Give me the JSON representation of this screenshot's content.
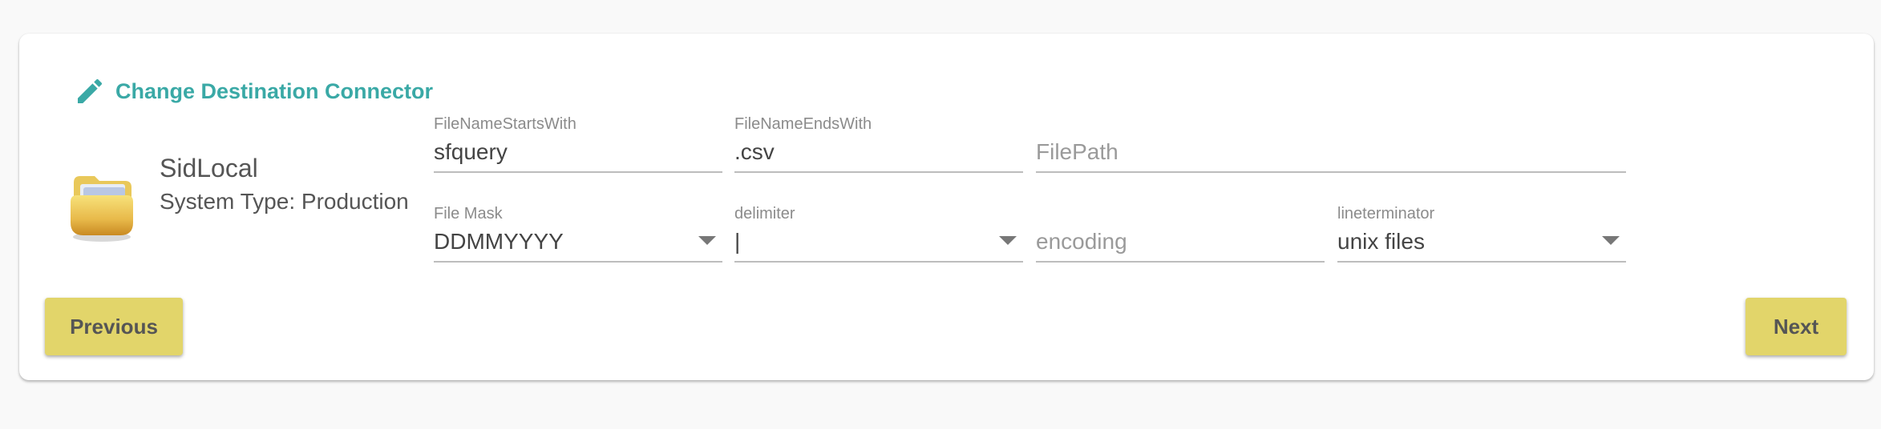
{
  "header": {
    "change_label": "Change Destination Connector",
    "accent_color": "#3aa9a6"
  },
  "connector": {
    "name": "SidLocal",
    "type_label": "System Type: Production",
    "icon": "folder-icon"
  },
  "fields": {
    "file_name_starts_with": {
      "label": "FileNameStartsWith",
      "value": "sfquery"
    },
    "file_name_ends_with": {
      "label": "FileNameEndsWith",
      "value": ".csv"
    },
    "file_path": {
      "placeholder": "FilePath",
      "value": ""
    },
    "file_mask": {
      "label": "File Mask",
      "value": "DDMMYYYY"
    },
    "delimiter": {
      "label": "delimiter",
      "value": "|"
    },
    "encoding": {
      "placeholder": "encoding",
      "value": ""
    },
    "lineterminator": {
      "label": "lineterminator",
      "value": "unix files"
    }
  },
  "footer": {
    "previous_label": "Previous",
    "next_label": "Next",
    "button_color": "#e2d56a"
  }
}
